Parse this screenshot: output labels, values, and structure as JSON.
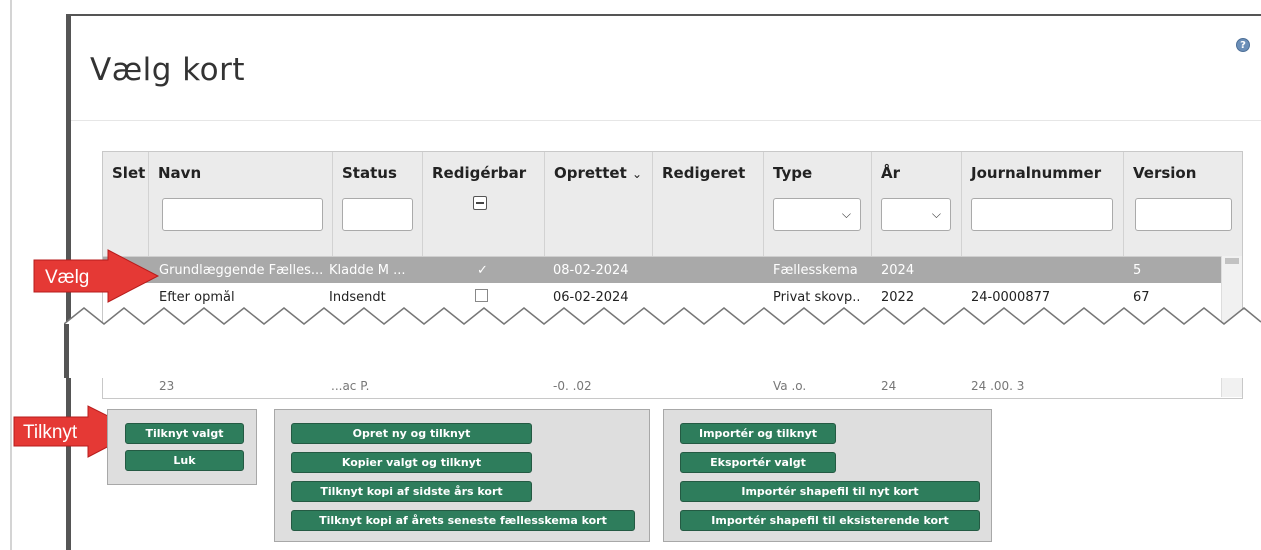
{
  "title": "Vælg kort",
  "help_icon": "help-icon",
  "columns": [
    "Slet",
    "Navn",
    "Status",
    "Redigérbar",
    "Oprettet",
    "Redigeret",
    "Type",
    "År",
    "Journalnummer",
    "Version"
  ],
  "sort_indicator": "⌄",
  "rows": [
    {
      "navn": "Grundlæggende Fælles...",
      "status": "Kladde M ...",
      "redigerbar": "✓",
      "oprettet": "08-02-2024",
      "redigeret": "",
      "type": "Fællesskema",
      "aar": "2024",
      "journalnummer": "",
      "version": "5"
    },
    {
      "navn": "Efter opmål",
      "status": "Indsendt",
      "redigerbar": "",
      "oprettet": "06-02-2024",
      "redigeret": "",
      "type": "Privat skovp...",
      "aar": "2022",
      "journalnummer": "24-0000877",
      "version": "67"
    }
  ],
  "bottom_row": {
    "navn": "23",
    "status": "...ac  P.",
    "oprettet": "-0.  .02",
    "type": "Va  .o.",
    "aar": "24",
    "journalnummer": "24  .00.  3"
  },
  "callouts": {
    "vaelg": "Vælg",
    "tilknyt": "Tilknyt"
  },
  "buttons": {
    "group1": [
      "Tilknyt valgt",
      "Luk"
    ],
    "group2": [
      "Opret ny og tilknyt",
      "Kopier valgt og tilknyt",
      "Tilknyt kopi af sidste års kort",
      "Tilknyt kopi af årets seneste fællesskema kort"
    ],
    "group3": [
      "Importér og tilknyt",
      "Eksportér valgt",
      "Importér shapefil til nyt kort",
      "Importér shapefil til eksisterende kort"
    ]
  },
  "colors": {
    "button": "#2e7d5c",
    "callout": "#e53935",
    "selected_row": "#a9a9a9"
  }
}
